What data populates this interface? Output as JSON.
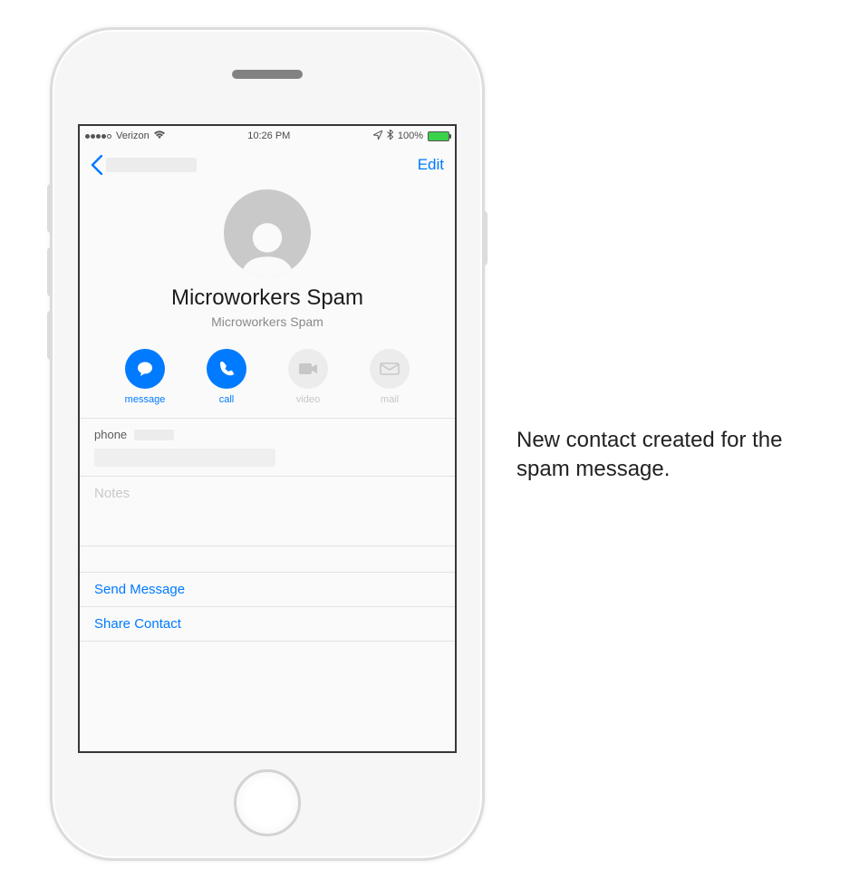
{
  "status": {
    "carrier": "Verizon",
    "time": "10:26 PM",
    "battery_pct": "100%"
  },
  "nav": {
    "edit": "Edit"
  },
  "contact": {
    "name": "Microworkers Spam",
    "company": "Microworkers Spam"
  },
  "actions": {
    "message": "message",
    "call": "call",
    "video": "video",
    "mail": "mail"
  },
  "cells": {
    "phone_label": "phone",
    "notes_placeholder": "Notes",
    "send_message": "Send Message",
    "share_contact": "Share Contact"
  },
  "caption": "New contact created for the spam message."
}
